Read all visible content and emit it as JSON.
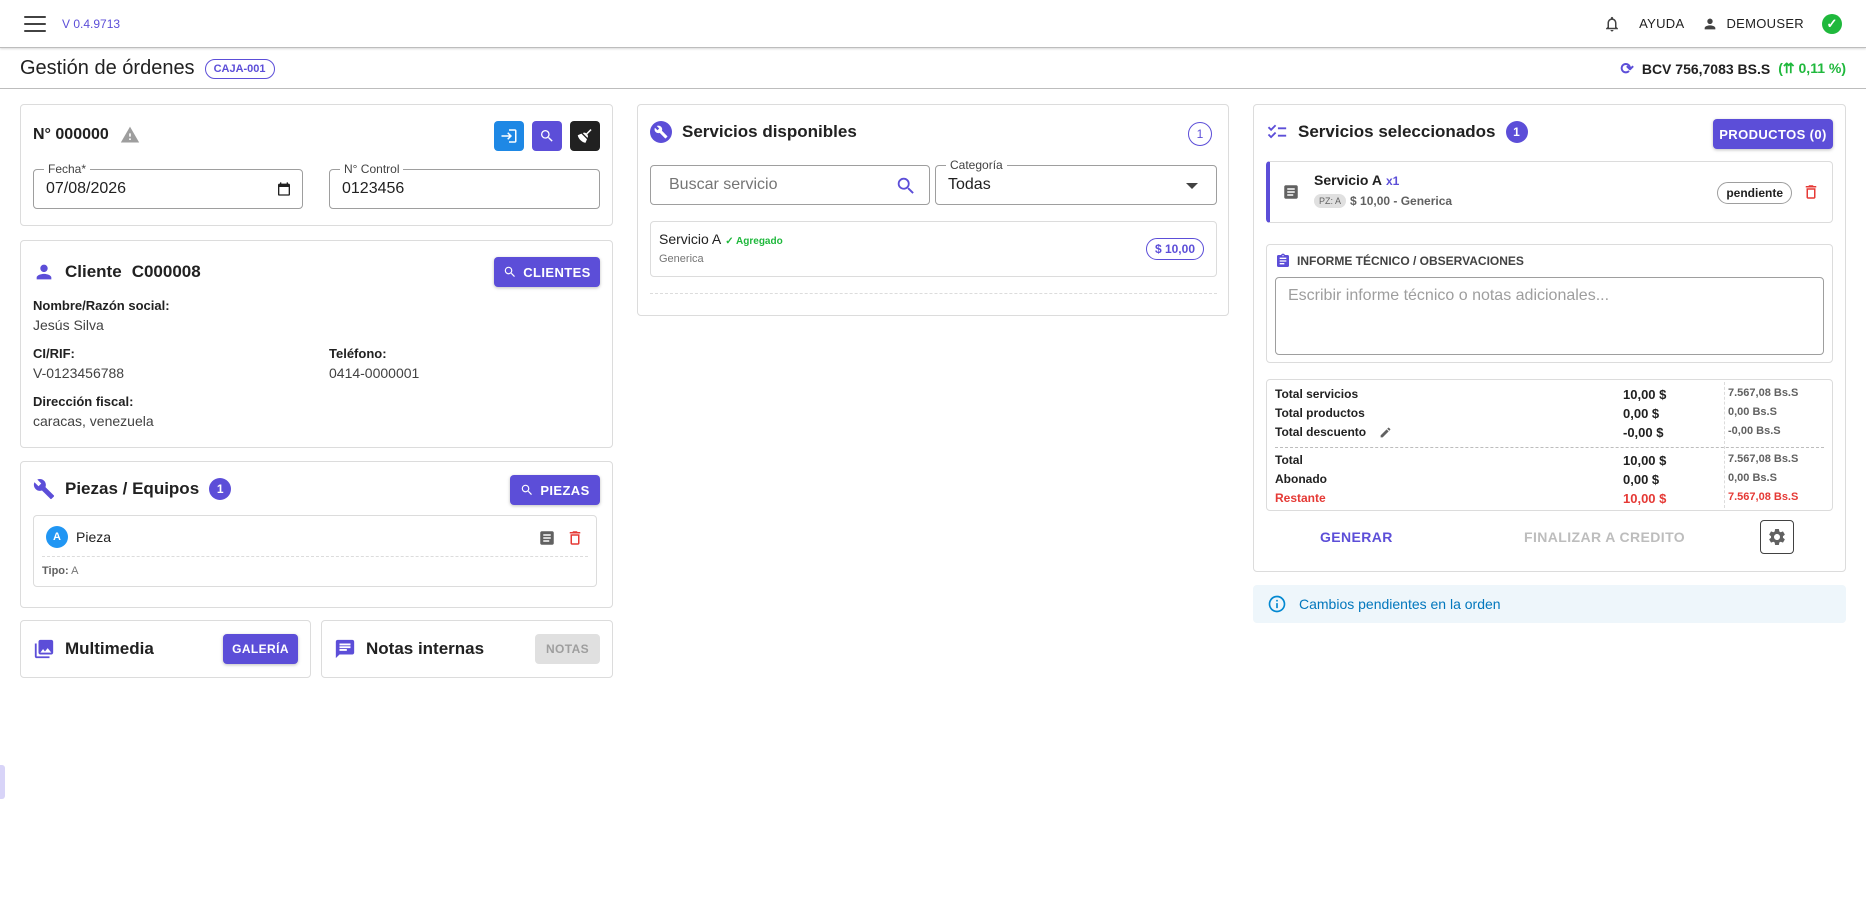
{
  "topbar": {
    "version": "V 0.4.9713",
    "help": "AYUDA",
    "user": "DEMOUSER"
  },
  "header": {
    "title": "Gestión de órdenes",
    "caja": "CAJA-001",
    "bcv": "BCV 756,7083 BS.S",
    "bcv_change": "(⇈ 0,11 %)"
  },
  "order": {
    "number_label": "N° 000000",
    "fecha_label": "Fecha*",
    "fecha_value": "07/08/2026",
    "control_label": "N° Control",
    "control_value": "0123456"
  },
  "client": {
    "title": "Cliente",
    "code": "C000008",
    "button": "CLIENTES",
    "name_label": "Nombre/Razón social:",
    "name_value": "Jesús Silva",
    "rif_label": "CI/RIF:",
    "rif_value": "V-0123456788",
    "phone_label": "Teléfono:",
    "phone_value": "0414-0000001",
    "address_label": "Dirección fiscal:",
    "address_value": "caracas, venezuela"
  },
  "pieces": {
    "title": "Piezas / Equipos",
    "count": "1",
    "button": "PIEZAS",
    "items": [
      {
        "avatar": "A",
        "name": "Pieza",
        "tipo_label": "Tipo:",
        "tipo_value": "A"
      }
    ]
  },
  "media": {
    "title": "Multimedia",
    "button": "GALERÍA"
  },
  "notes": {
    "title": "Notas internas",
    "button": "NOTAS"
  },
  "services": {
    "title": "Servicios disponibles",
    "count": "1",
    "search_placeholder": "Buscar servicio",
    "category_label": "Categoría",
    "category_value": "Todas",
    "items": [
      {
        "name": "Servicio A",
        "status": "✓ Agregado",
        "category": "Generica",
        "price": "$ 10,00"
      }
    ]
  },
  "selected": {
    "title": "Servicios seleccionados",
    "count": "1",
    "products_button": "PRODUCTOS (0)",
    "items": [
      {
        "name": "Servicio A",
        "qty": "x1",
        "pz": "PZ: A",
        "detail": "$ 10,00 - Generica",
        "status": "pendiente"
      }
    ],
    "report_title": "INFORME TÉCNICO / OBSERVACIONES",
    "report_placeholder": "Escribir informe técnico o notas adicionales...",
    "totals": [
      {
        "label": "Total servicios",
        "usd": "10,00 $",
        "bs": "7.567,08 Bs.S"
      },
      {
        "label": "Total productos",
        "usd": "0,00 $",
        "bs": "0,00 Bs.S"
      },
      {
        "label": "Total descuento",
        "usd": "-0,00 $",
        "bs": "-0,00 Bs.S"
      },
      {
        "label": "Total",
        "usd": "10,00 $",
        "bs": "7.567,08 Bs.S"
      },
      {
        "label": "Abonado",
        "usd": "0,00 $",
        "bs": "0,00 Bs.S"
      },
      {
        "label": "Restante",
        "usd": "10,00 $",
        "bs": "7.567,08 Bs.S"
      }
    ],
    "generate": "GENERAR",
    "finalize": "FINALIZAR A CREDITO"
  },
  "alert": {
    "text": "Cambios pendientes en la orden"
  },
  "colors": {
    "accent": "#5c4ed8",
    "success": "#1fb83c",
    "danger": "#e53935",
    "info": "#0288d1"
  }
}
